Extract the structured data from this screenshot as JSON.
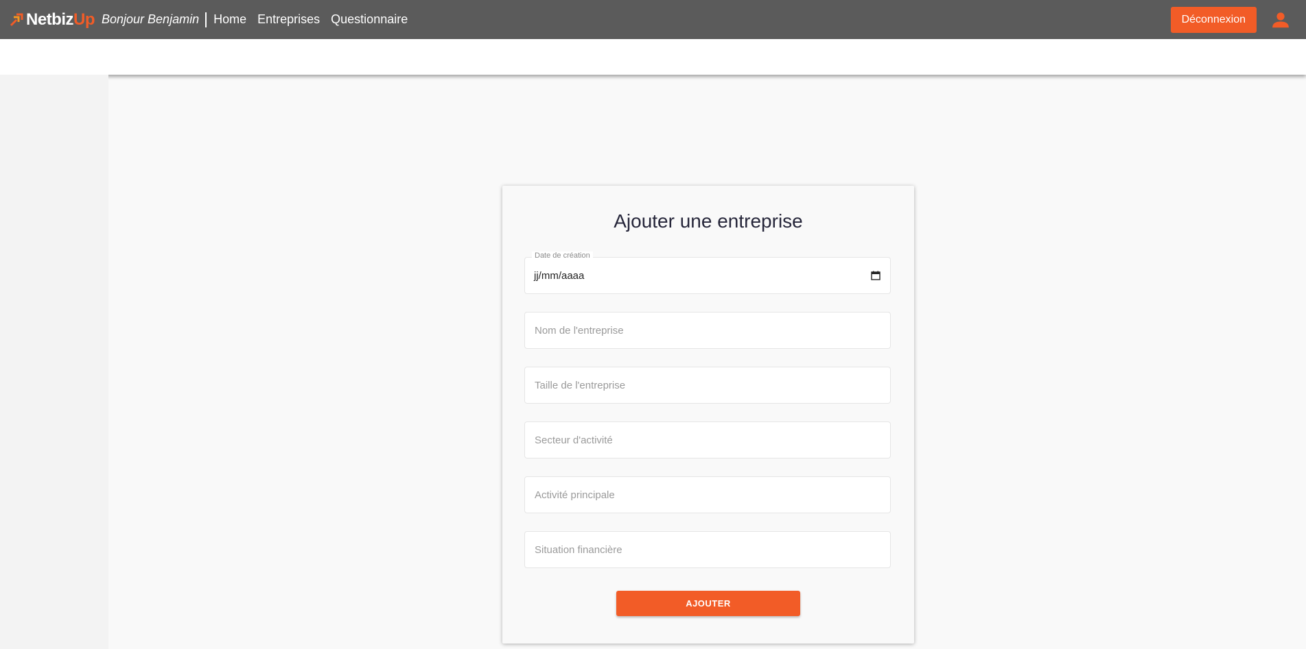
{
  "navbar": {
    "brand_main": "Netbiz",
    "brand_accent": "Up",
    "greeting": "Bonjour Benjamin",
    "links": [
      "Home",
      "Entreprises",
      "Questionnaire"
    ],
    "logout_label": "Déconnexion",
    "user_icon": "user-icon",
    "logo_icon": "arrows-up-right-icon"
  },
  "form": {
    "title": "Ajouter une entreprise",
    "date_label": "Date de création",
    "date_value": "jj/mm/aaaa",
    "date_icon": "calendar-icon",
    "placeholders": {
      "name": "Nom de l'entreprise",
      "size": "Taille de l'entreprise",
      "sector": "Secteur d'activité",
      "activity": "Activité principale",
      "finance": "Situation financière"
    },
    "submit_label": "AJOUTER"
  },
  "colors": {
    "accent": "#f25c27",
    "navbar": "#5b5b5b",
    "background": "#f9f9f9"
  }
}
